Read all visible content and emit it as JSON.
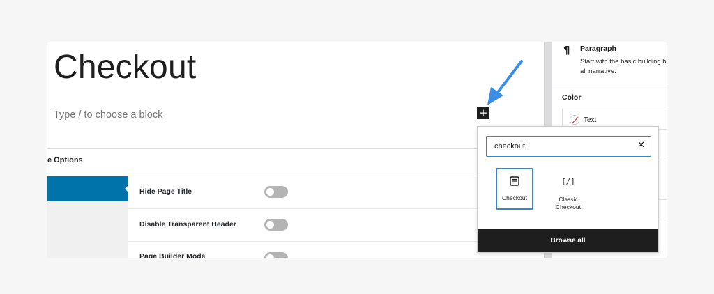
{
  "editor": {
    "page_title": "Checkout",
    "block_placeholder": "Type / to choose a block",
    "inserter_symbol": "+"
  },
  "meta_box": {
    "header": "e Options",
    "rows": [
      {
        "label": "Hide Page Title"
      },
      {
        "label": "Disable Transparent Header"
      },
      {
        "label": "Page Builder Mode"
      }
    ],
    "active_tab_color": "#0073aa"
  },
  "sidebar": {
    "paragraph_icon": "¶",
    "paragraph_title": "Paragraph",
    "paragraph_desc_line1": "Start with the basic building b",
    "paragraph_desc_line2": "all narrative.",
    "color_label": "Color",
    "color_text": "Text"
  },
  "inserter": {
    "search_value": "checkout",
    "clear_symbol": "✕",
    "results": [
      {
        "label": "Checkout",
        "icon": "checkout-block-icon",
        "selected": true
      },
      {
        "label_line1": "Classic",
        "label_line2": "Checkout",
        "icon": "shortcode-icon",
        "glyph": "[/]"
      }
    ],
    "browse_all_label": "Browse all",
    "accent_color": "#3a85c8"
  },
  "annotation": {
    "arrow_color": "#3a8ee6",
    "icon": "arrow-pointer-icon"
  }
}
